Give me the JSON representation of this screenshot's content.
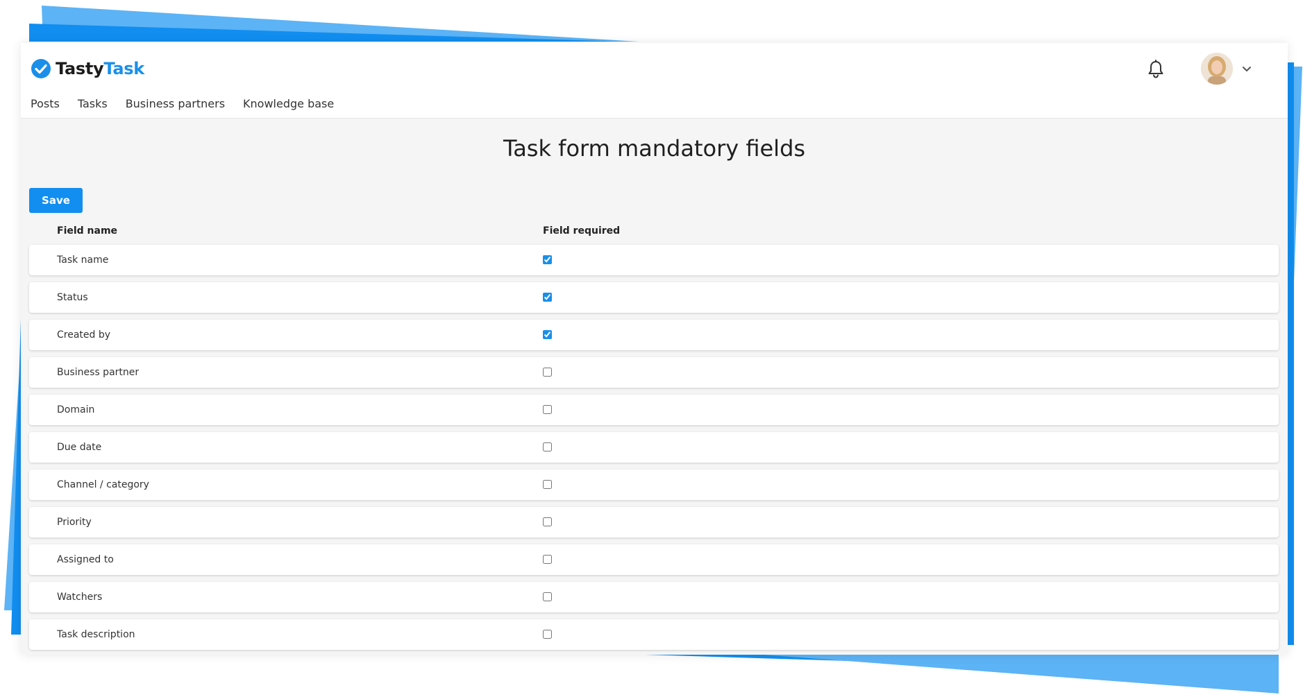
{
  "brand": {
    "name_part1": "Tasty",
    "name_part2": "Task",
    "accent": "#1a8fea",
    "ribbon_color": "#118ef0",
    "ribbon_light": "#5cb3f5"
  },
  "nav": {
    "items": [
      "Posts",
      "Tasks",
      "Business partners",
      "Knowledge base"
    ]
  },
  "header": {
    "notification_icon": "bell-icon",
    "user_menu_icon": "chevron-down-icon"
  },
  "page": {
    "title": "Task form mandatory fields",
    "save_label": "Save"
  },
  "table": {
    "columns": [
      "Field name",
      "Field required"
    ],
    "rows": [
      {
        "name": "Task name",
        "required": true
      },
      {
        "name": "Status",
        "required": true
      },
      {
        "name": "Created by",
        "required": true
      },
      {
        "name": "Business partner",
        "required": false
      },
      {
        "name": "Domain",
        "required": false
      },
      {
        "name": "Due date",
        "required": false
      },
      {
        "name": "Channel / category",
        "required": false
      },
      {
        "name": "Priority",
        "required": false
      },
      {
        "name": "Assigned to",
        "required": false
      },
      {
        "name": "Watchers",
        "required": false
      },
      {
        "name": "Task description",
        "required": false
      }
    ]
  }
}
